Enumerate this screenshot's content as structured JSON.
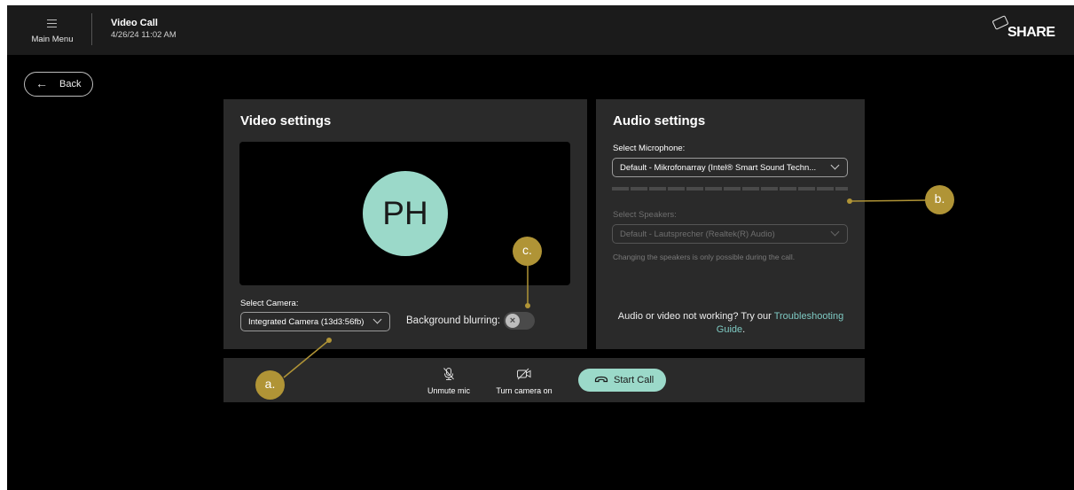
{
  "topbar": {
    "menu_label": "Main Menu",
    "title": "Video Call",
    "datetime": "4/26/24  11:02 AM",
    "logo_text": "SHARE"
  },
  "back_label": "Back",
  "video": {
    "title": "Video settings",
    "avatar_initials": "PH",
    "camera_label": "Select Camera:",
    "camera_value": "Integrated Camera (13d3:56fb)",
    "blur_label": "Background blurring:",
    "blur_enabled": false
  },
  "audio": {
    "title": "Audio settings",
    "mic_label": "Select Microphone:",
    "mic_value": "Default - Mikrofonarray (Intel® Smart Sound Techn...",
    "speakers_label": "Select Speakers:",
    "speakers_value": "Default - Lautsprecher (Realtek(R) Audio)",
    "speakers_hint": "Changing the speakers is only possible during the call.",
    "trouble_text": "Audio or video not working? Try our ",
    "trouble_link": "Troubleshooting Guide",
    "trouble_end": "."
  },
  "callbar": {
    "unmute_label": "Unmute mic",
    "camera_label": "Turn camera on",
    "start_label": "Start Call"
  },
  "annotations": {
    "a": "a.",
    "b": "b.",
    "c": "c."
  },
  "colors": {
    "accent": "#9bd9c9",
    "annotation": "#b09436",
    "link": "#7ec9c2",
    "panel": "#2a2a2a"
  }
}
